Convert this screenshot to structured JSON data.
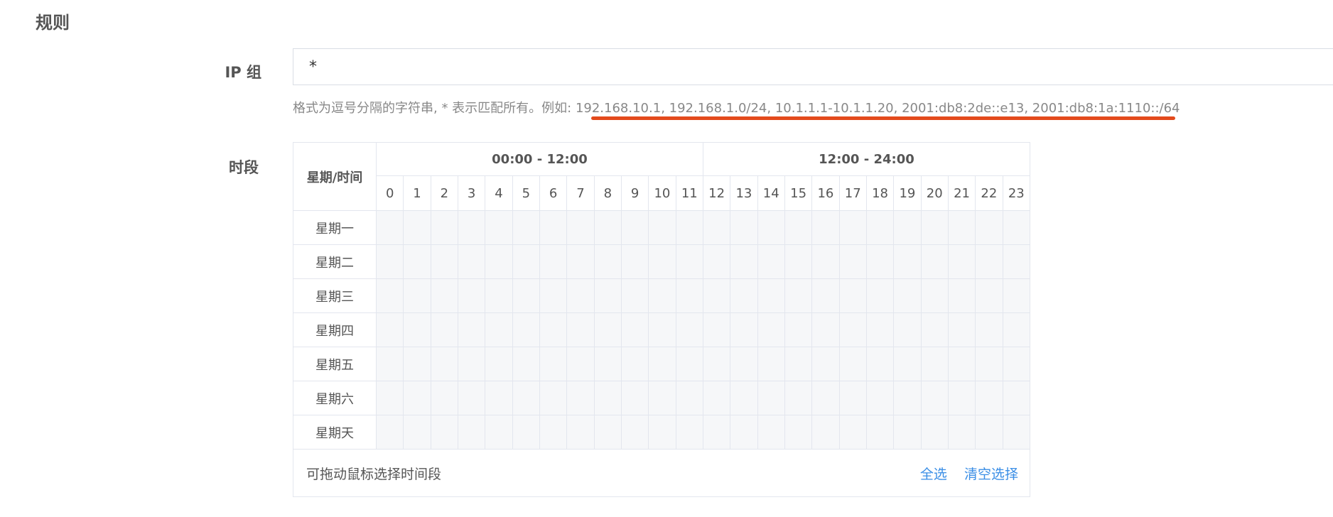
{
  "section": {
    "title": "规则"
  },
  "ip_group": {
    "label": "IP 组",
    "value": "*",
    "hint_prefix": "格式为逗号分隔的字符串, * 表示匹配所有。例如: ",
    "hint_example": "192.168.10.1, 192.168.1.0/24, 10.1.1.1-10.1.1.20, 2001:db8:2de::e13, 2001:db8:1a:1110::/64"
  },
  "schedule": {
    "label": "时段",
    "corner": "星期/时间",
    "first_half": "00:00 - 12:00",
    "second_half": "12:00 - 24:00",
    "hours": [
      "0",
      "1",
      "2",
      "3",
      "4",
      "5",
      "6",
      "7",
      "8",
      "9",
      "10",
      "11",
      "12",
      "13",
      "14",
      "15",
      "16",
      "17",
      "18",
      "19",
      "20",
      "21",
      "22",
      "23"
    ],
    "days": [
      "星期一",
      "星期二",
      "星期三",
      "星期四",
      "星期五",
      "星期六",
      "星期天"
    ],
    "footer_text": "可拖动鼠标选择时间段",
    "select_all": "全选",
    "clear_selection": "清空选择"
  },
  "colors": {
    "accent": "#3a8ee6",
    "underline": "#e34a1c",
    "cell_bg": "#f6f7f9"
  }
}
